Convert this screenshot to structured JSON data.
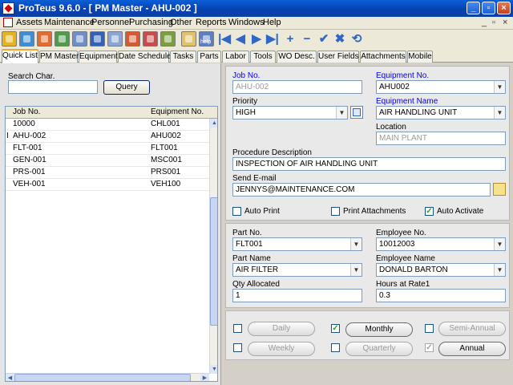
{
  "window": {
    "title": "ProTeus 9.6.0 - [ PM Master - AHU-002 ]"
  },
  "menu": {
    "items": [
      "Assets",
      "Maintenance",
      "Personnel",
      "Purchasing",
      "Other",
      "Reports",
      "Windows",
      "Help"
    ]
  },
  "toolbar": {
    "icons": [
      "assets-icon",
      "maintenance-icon",
      "work-order-icon",
      "report-icon",
      "print-icon",
      "calendar-icon",
      "document-icon",
      "personnel-icon",
      "user-icon",
      "tools-icon",
      "notes-icon",
      "help-icon"
    ],
    "help_label": "help",
    "nav": [
      "first-record-icon",
      "previous-record-icon",
      "next-record-icon",
      "last-record-icon",
      "add-record-icon",
      "delete-record-icon",
      "save-record-icon",
      "cancel-record-icon",
      "refresh-icon"
    ],
    "nav_glyphs": [
      "|◀",
      "◀",
      "▶",
      "▶|",
      "+",
      "−",
      "✔",
      "✖",
      "⟲"
    ]
  },
  "tabs": [
    "Quick List",
    "PM Master",
    "Equipment",
    "Date Schedule",
    "Tasks",
    "Parts",
    "Labor",
    "Tools",
    "WO Desc.",
    "User Fields",
    "Attachments",
    "Mobile"
  ],
  "quicklist": {
    "search_label": "Search Char.",
    "search_value": "",
    "query_label": "Query",
    "columns": [
      "Job No.",
      "Equipment No."
    ],
    "rows": [
      {
        "job": "10000",
        "equip": "CHL001"
      },
      {
        "job": "AHU-002",
        "equip": "AHU002",
        "selected": true
      },
      {
        "job": "FLT-001",
        "equip": "FLT001"
      },
      {
        "job": "GEN-001",
        "equip": "MSC001"
      },
      {
        "job": "PRS-001",
        "equip": "PRS001"
      },
      {
        "job": "VEH-001",
        "equip": "VEH100"
      }
    ]
  },
  "form": {
    "job_no_label": "Job No.",
    "job_no": "AHU-002",
    "equipment_no_label": "Equipment No.",
    "equipment_no": "AHU002",
    "priority_label": "Priority",
    "priority": "HIGH",
    "equipment_name_label": "Equipment Name",
    "equipment_name": "AIR HANDLING UNIT",
    "location_label": "Location",
    "location": "MAIN PLANT",
    "procedure_label": "Procedure Description",
    "procedure": "INSPECTION OF AIR HANDLING UNIT",
    "email_label": "Send E-mail",
    "email": "JENNYS@MAINTENANCE.COM",
    "auto_print_label": "Auto Print",
    "auto_print": false,
    "print_attachments_label": "Print Attachments",
    "print_attachments": false,
    "auto_activate_label": "Auto Activate",
    "auto_activate": true
  },
  "parts": {
    "part_no_label": "Part No.",
    "part_no": "FLT001",
    "employee_no_label": "Employee No.",
    "employee_no": "10012003",
    "part_name_label": "Part Name",
    "part_name": "AIR FILTER",
    "employee_name_label": "Employee Name",
    "employee_name": "DONALD BARTON",
    "qty_label": "Qty Allocated",
    "qty": "1",
    "hours_label": "Hours at Rate1",
    "hours": "0.3"
  },
  "schedule": {
    "daily_label": "Daily",
    "daily": false,
    "monthly_label": "Monthly",
    "monthly": true,
    "semiannual_label": "Semi-Annual",
    "semiannual": false,
    "weekly_label": "Weekly",
    "weekly": false,
    "quarterly_label": "Quarterly",
    "quarterly": false,
    "annual_label": "Annual",
    "annual": true
  },
  "colors": {
    "accent_label": "#0000ee",
    "check": "#21a121",
    "titlebar": "#0842b0"
  }
}
